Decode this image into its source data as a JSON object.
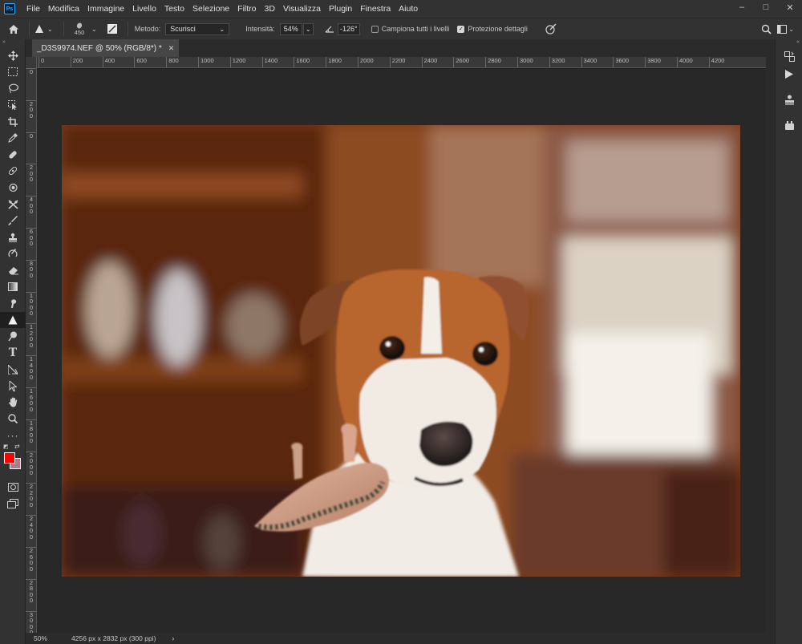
{
  "menubar": {
    "app_icon": "Ps",
    "items": [
      "File",
      "Modifica",
      "Immagine",
      "Livello",
      "Testo",
      "Selezione",
      "Filtro",
      "3D",
      "Visualizza",
      "Plugin",
      "Finestra",
      "Aiuto"
    ],
    "window_controls": {
      "minimize": "–",
      "maximize": "□",
      "close": "✕"
    }
  },
  "options": {
    "brush_size": "450",
    "method_label": "Metodo:",
    "method_value": "Scurisci",
    "intensity_label": "Intensità:",
    "intensity_value": "54%",
    "angle_value": "-126°",
    "sample_all_label": "Campiona tutti i livelli",
    "sample_all_checked": false,
    "protect_detail_label": "Protezione dettagli",
    "protect_detail_checked": true
  },
  "document": {
    "tab_title": "_D3S9974.NEF @ 50% (RGB/8*) *",
    "zoom": "50%",
    "doc_info": "4256 px x 2832 px (300 ppi)"
  },
  "ruler": {
    "h_labels": [
      "0",
      "200",
      "400",
      "600",
      "800",
      "1000",
      "1200",
      "1400",
      "1600",
      "1800",
      "2000",
      "2200",
      "2400",
      "2600",
      "2800",
      "3000",
      "3200",
      "3400",
      "3600",
      "3800",
      "4000",
      "4200"
    ],
    "v_labels": [
      "0",
      "200",
      "0",
      "200",
      "400",
      "600",
      "800",
      "1000",
      "1200",
      "1400",
      "1600",
      "1800",
      "2000",
      "2200",
      "2400",
      "2600",
      "2800",
      "3000",
      "3200"
    ]
  },
  "tools": [
    "move-tool",
    "marquee-tool",
    "lasso-tool",
    "object-select-tool",
    "crop-tool",
    "eyedropper-tool",
    "spot-healing-tool",
    "bandage-tool",
    "patch-tool",
    "content-aware-move-tool",
    "brush-tool",
    "clone-stamp-tool",
    "history-brush-tool",
    "eraser-tool",
    "gradient-tool",
    "smudge-tool",
    "sharpen-tool",
    "dodge-tool",
    "type-tool",
    "path-select-tool",
    "direct-select-tool",
    "hand-tool",
    "zoom-tool",
    "more-tools"
  ],
  "colors": {
    "foreground": "#ff0000",
    "background": "#b07a88",
    "accent": "#31a8ff"
  }
}
